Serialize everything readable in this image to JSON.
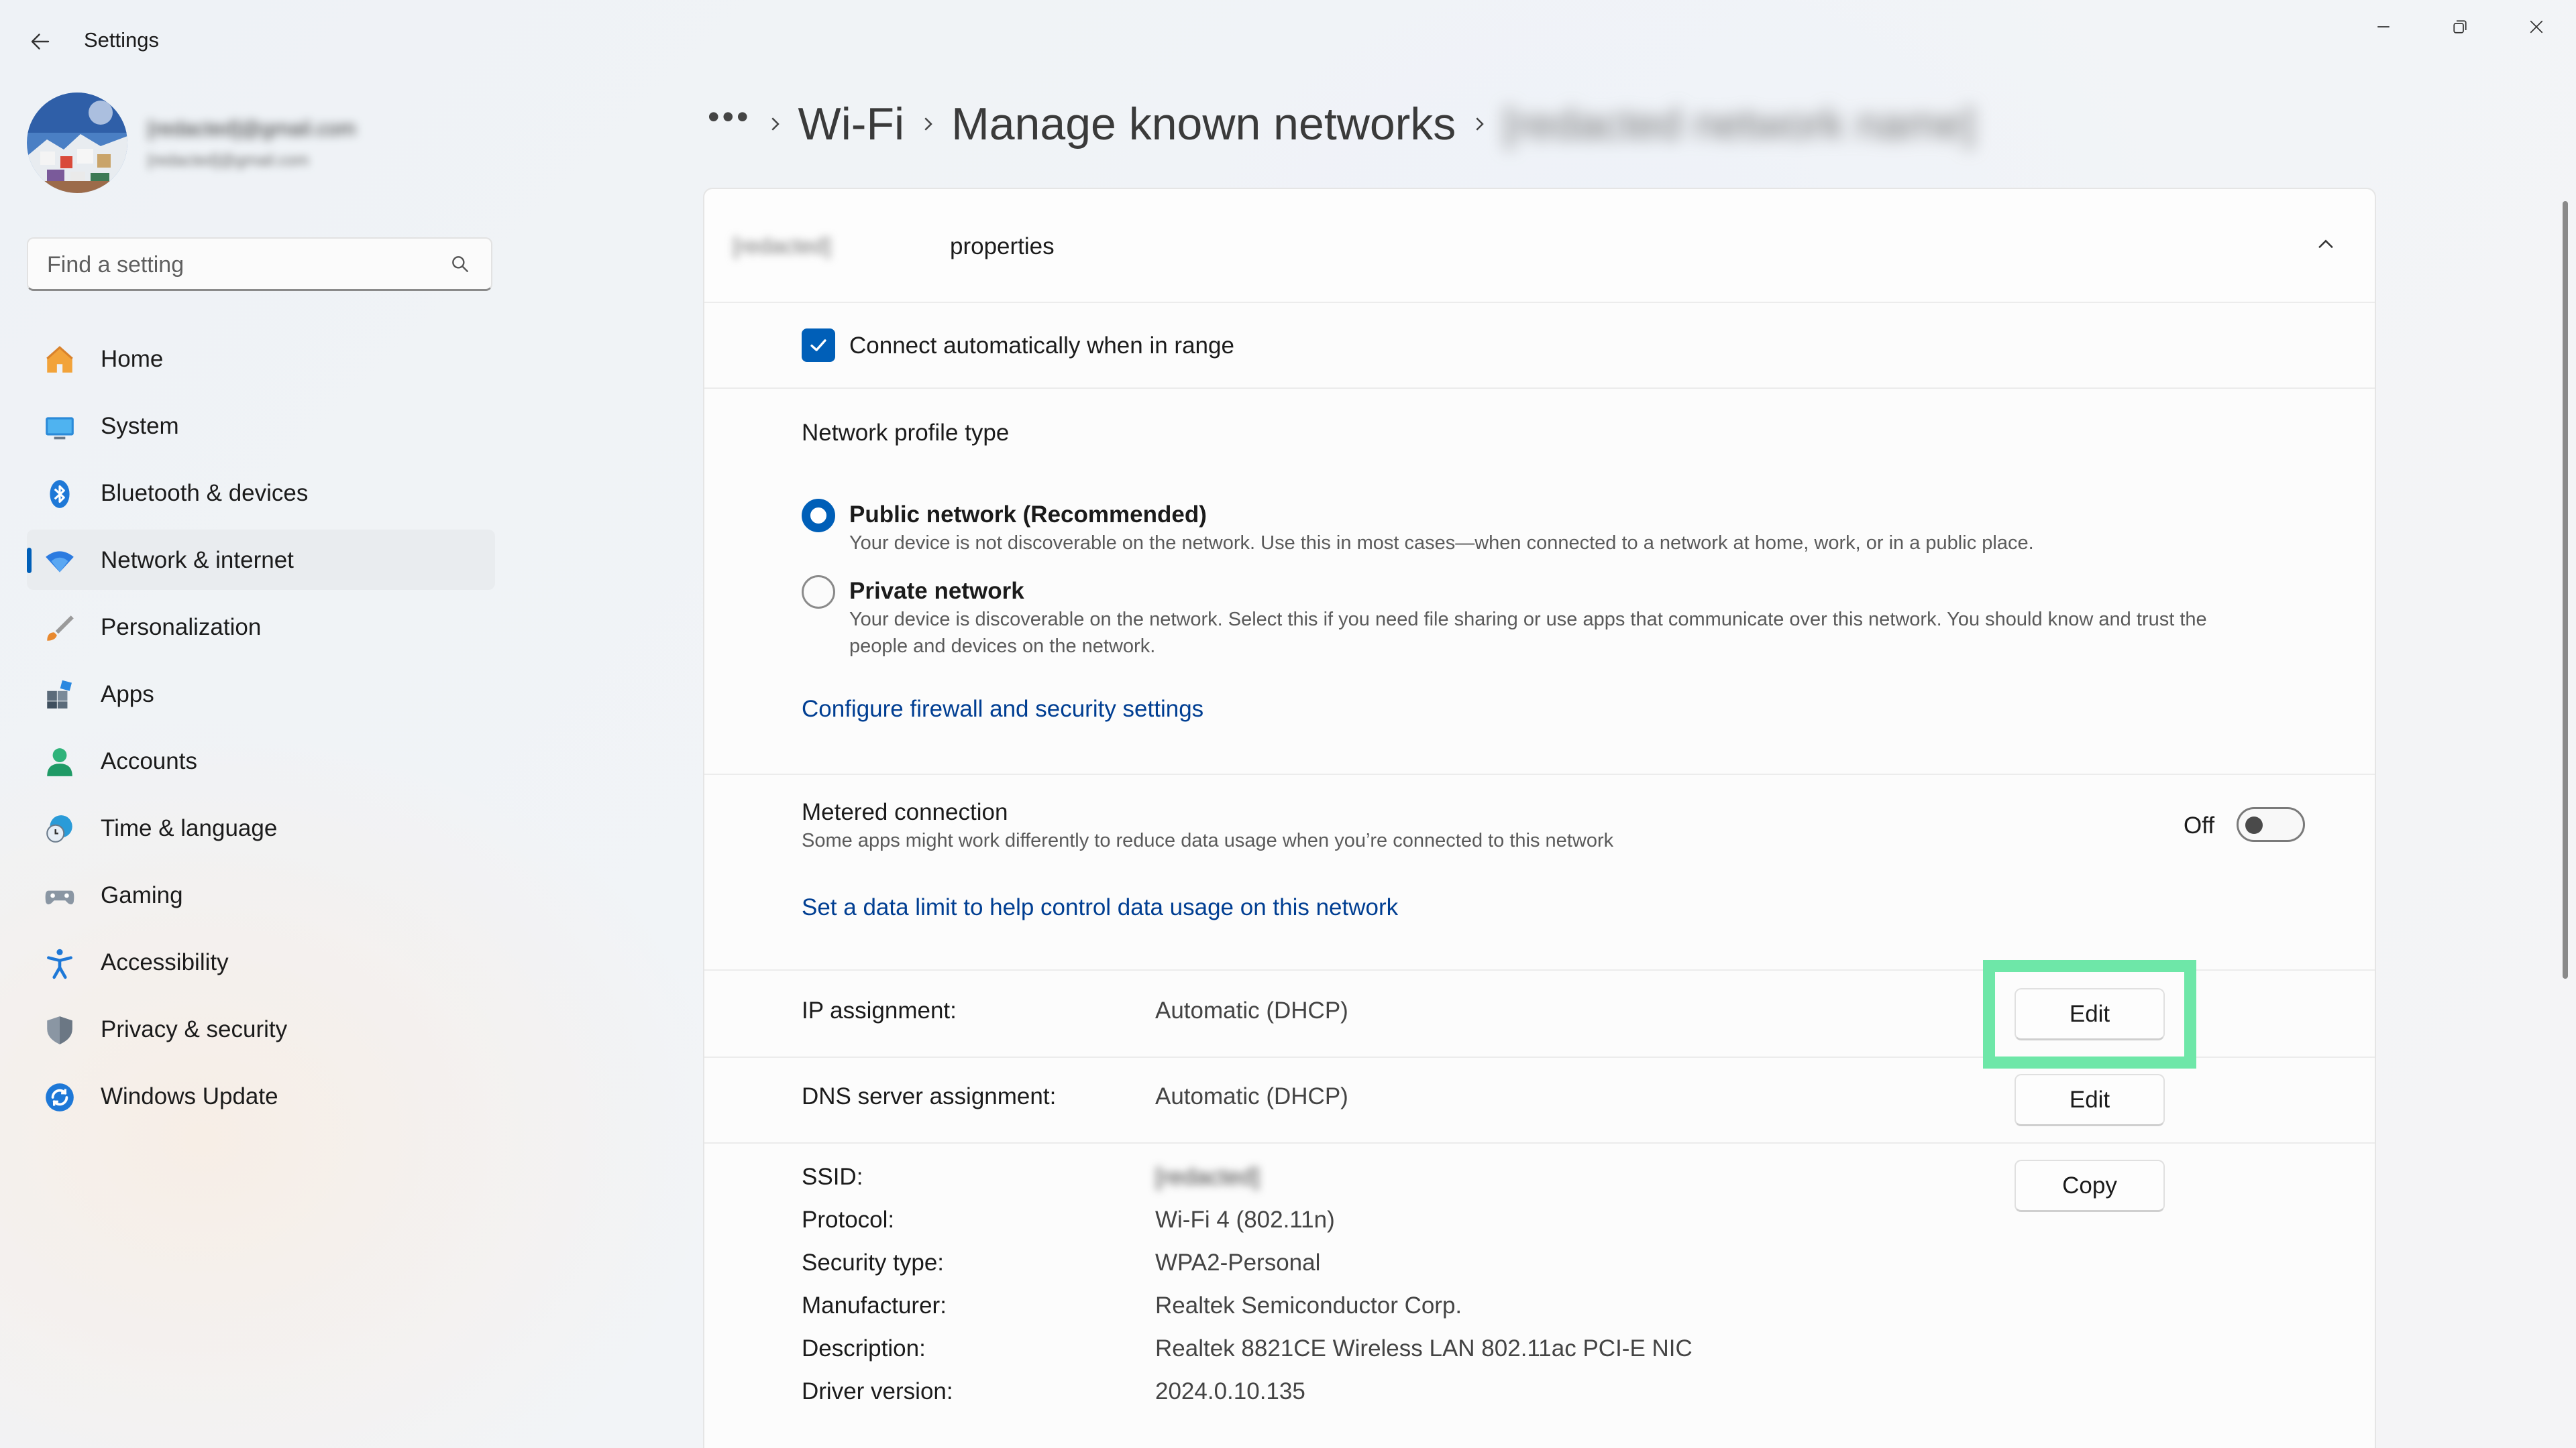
{
  "app": {
    "title": "Settings"
  },
  "profile": {
    "name": "[redacted]@gmail.com",
    "email": "[redacted]@gmail.com"
  },
  "search": {
    "placeholder": "Find a setting"
  },
  "nav": {
    "items": [
      {
        "label": "Home",
        "icon": "home-icon"
      },
      {
        "label": "System",
        "icon": "system-icon"
      },
      {
        "label": "Bluetooth & devices",
        "icon": "bluetooth-icon"
      },
      {
        "label": "Network & internet",
        "icon": "wifi-icon",
        "active": true
      },
      {
        "label": "Personalization",
        "icon": "brush-icon"
      },
      {
        "label": "Apps",
        "icon": "apps-icon"
      },
      {
        "label": "Accounts",
        "icon": "person-icon"
      },
      {
        "label": "Time & language",
        "icon": "clock-globe-icon"
      },
      {
        "label": "Gaming",
        "icon": "gamepad-icon"
      },
      {
        "label": "Accessibility",
        "icon": "accessibility-icon"
      },
      {
        "label": "Privacy & security",
        "icon": "shield-icon"
      },
      {
        "label": "Windows Update",
        "icon": "update-icon"
      }
    ]
  },
  "breadcrumb": {
    "more": "•••",
    "items": [
      "Wi-Fi",
      "Manage known networks"
    ],
    "current_network": "[redacted network name]"
  },
  "properties": {
    "network_name": "[redacted]",
    "title_suffix": "properties",
    "connect_auto": {
      "label": "Connect automatically when in range",
      "checked": true
    },
    "profile_type": {
      "heading": "Network profile type",
      "options": [
        {
          "label": "Public network (Recommended)",
          "desc": "Your device is not discoverable on the network. Use this in most cases—when connected to a network at home, work, or in a public place.",
          "selected": true
        },
        {
          "label": "Private network",
          "desc_line1": "Your device is discoverable on the network. Select this if you need file sharing or use apps that communicate over this network. You should know and trust the",
          "desc_line2": "people and devices on the network.",
          "selected": false
        }
      ],
      "firewall_link": "Configure firewall and security settings"
    },
    "metered": {
      "label": "Metered connection",
      "desc": "Some apps might work differently to reduce data usage when you’re connected to this network",
      "state": "Off",
      "enabled": false,
      "data_limit_link": "Set a data limit to help control data usage on this network"
    },
    "ip_assignment": {
      "label": "IP assignment:",
      "value": "Automatic (DHCP)",
      "button": "Edit"
    },
    "dns_assignment": {
      "label": "DNS server assignment:",
      "value": "Automatic (DHCP)",
      "button": "Edit"
    },
    "details": [
      {
        "label": "SSID:",
        "value": "[redacted]"
      },
      {
        "label": "Protocol:",
        "value": "Wi-Fi 4 (802.11n)"
      },
      {
        "label": "Security type:",
        "value": "WPA2-Personal"
      },
      {
        "label": "Manufacturer:",
        "value": "Realtek Semiconductor Corp."
      },
      {
        "label": "Description:",
        "value": "Realtek 8821CE Wireless LAN 802.11ac PCI-E NIC"
      },
      {
        "label": "Driver version:",
        "value": "2024.0.10.135"
      }
    ],
    "copy_button": "Copy"
  },
  "colors": {
    "accent": "#005fb8",
    "link": "#003e92",
    "highlight": "#6ee7a8"
  }
}
